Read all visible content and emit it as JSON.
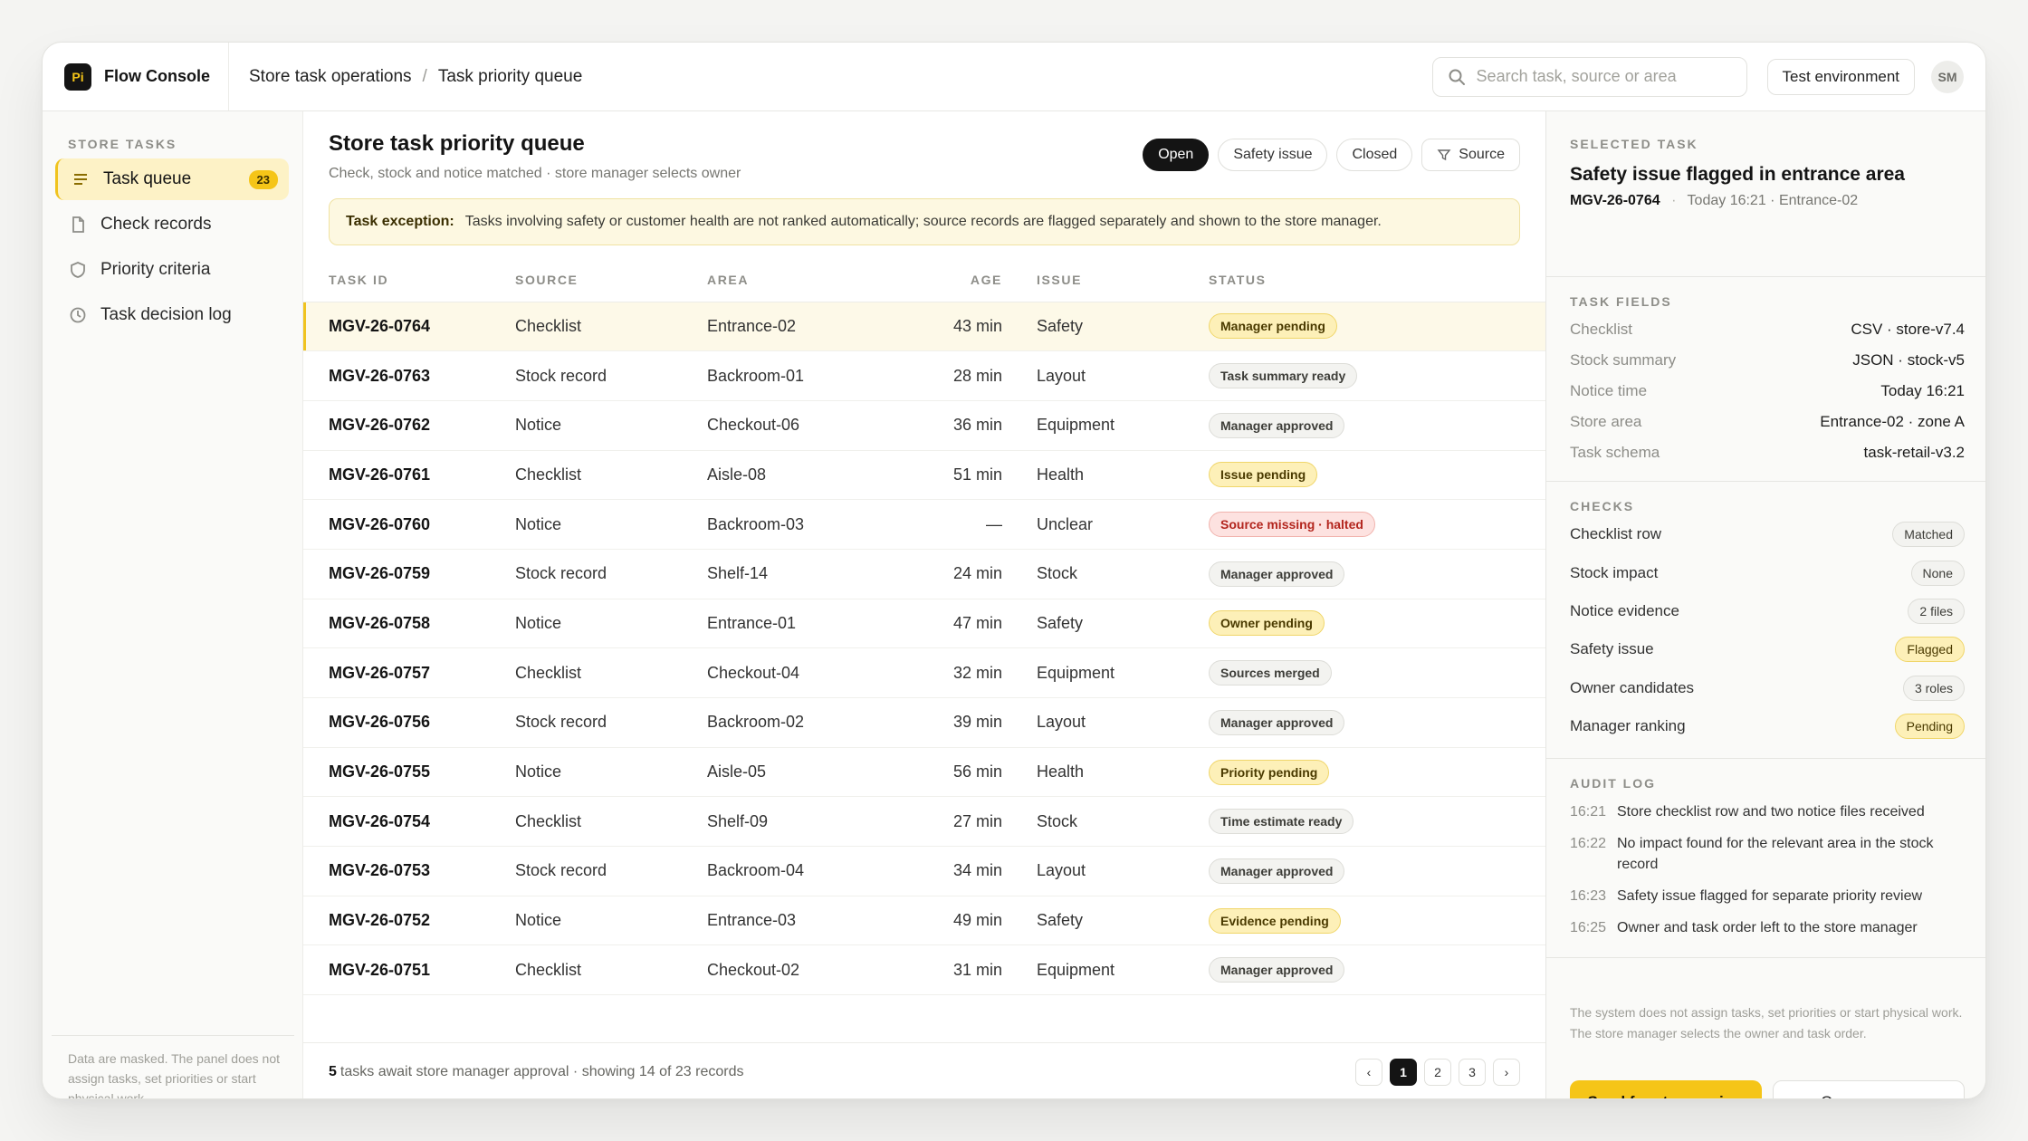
{
  "app": {
    "logo_text": "Pi",
    "name": "Flow Console"
  },
  "breadcrumb": [
    "Store task operations",
    "Task priority queue"
  ],
  "header": {
    "search_placeholder": "Search task, source or area",
    "environment_label": "Test environment",
    "user_initials": "SM"
  },
  "sidebar": {
    "heading": "STORE TASKS",
    "items": [
      {
        "label": "Task queue",
        "icon": "list-icon",
        "badge": "23",
        "active": true
      },
      {
        "label": "Check records",
        "icon": "file-icon"
      },
      {
        "label": "Priority criteria",
        "icon": "shield-icon"
      },
      {
        "label": "Task decision log",
        "icon": "clock-icon"
      }
    ],
    "footer": "Data are masked. The panel does not assign tasks, set priorities or start physical work."
  },
  "main": {
    "title": "Store task priority queue",
    "subtitle": "Check, stock and notice matched · store manager selects owner",
    "filters": [
      "Open",
      "Safety issue",
      "Closed",
      "Source"
    ],
    "exception_label": "Task exception:",
    "exception_text": "Tasks involving safety or customer health are not ranked automatically; source records are flagged separately and shown to the store manager.",
    "columns": [
      "TASK ID",
      "SOURCE",
      "AREA",
      "AGE",
      "ISSUE",
      "STATUS"
    ],
    "rows": [
      {
        "id": "MGV-26-0764",
        "source": "Checklist",
        "area": "Entrance-02",
        "age": "43 min",
        "issue": "Safety",
        "status": "Manager pending",
        "tone": "pending",
        "selected": true
      },
      {
        "id": "MGV-26-0763",
        "source": "Stock record",
        "area": "Backroom-01",
        "age": "28 min",
        "issue": "Layout",
        "status": "Task summary ready",
        "tone": "neutral"
      },
      {
        "id": "MGV-26-0762",
        "source": "Notice",
        "area": "Checkout-06",
        "age": "36 min",
        "issue": "Equipment",
        "status": "Manager approved",
        "tone": "neutral"
      },
      {
        "id": "MGV-26-0761",
        "source": "Checklist",
        "area": "Aisle-08",
        "age": "51 min",
        "issue": "Health",
        "status": "Issue pending",
        "tone": "pending"
      },
      {
        "id": "MGV-26-0760",
        "source": "Notice",
        "area": "Backroom-03",
        "age": "—",
        "issue": "Unclear",
        "status": "Source missing · halted",
        "tone": "halted"
      },
      {
        "id": "MGV-26-0759",
        "source": "Stock record",
        "area": "Shelf-14",
        "age": "24 min",
        "issue": "Stock",
        "status": "Manager approved",
        "tone": "neutral"
      },
      {
        "id": "MGV-26-0758",
        "source": "Notice",
        "area": "Entrance-01",
        "age": "47 min",
        "issue": "Safety",
        "status": "Owner pending",
        "tone": "pending"
      },
      {
        "id": "MGV-26-0757",
        "source": "Checklist",
        "area": "Checkout-04",
        "age": "32 min",
        "issue": "Equipment",
        "status": "Sources merged",
        "tone": "neutral"
      },
      {
        "id": "MGV-26-0756",
        "source": "Stock record",
        "area": "Backroom-02",
        "age": "39 min",
        "issue": "Layout",
        "status": "Manager approved",
        "tone": "neutral"
      },
      {
        "id": "MGV-26-0755",
        "source": "Notice",
        "area": "Aisle-05",
        "age": "56 min",
        "issue": "Health",
        "status": "Priority pending",
        "tone": "pending"
      },
      {
        "id": "MGV-26-0754",
        "source": "Checklist",
        "area": "Shelf-09",
        "age": "27 min",
        "issue": "Stock",
        "status": "Time estimate ready",
        "tone": "neutral"
      },
      {
        "id": "MGV-26-0753",
        "source": "Stock record",
        "area": "Backroom-04",
        "age": "34 min",
        "issue": "Layout",
        "status": "Manager approved",
        "tone": "neutral"
      },
      {
        "id": "MGV-26-0752",
        "source": "Notice",
        "area": "Entrance-03",
        "age": "49 min",
        "issue": "Safety",
        "status": "Evidence pending",
        "tone": "pending"
      },
      {
        "id": "MGV-26-0751",
        "source": "Checklist",
        "area": "Checkout-02",
        "age": "31 min",
        "issue": "Equipment",
        "status": "Manager approved",
        "tone": "neutral"
      }
    ],
    "footer_count": "5",
    "footer_text": "tasks await store manager approval · showing 14 of 23 records",
    "pages": [
      "‹",
      "1",
      "2",
      "3",
      "›"
    ],
    "current_page": "1"
  },
  "panel": {
    "selected_label": "SELECTED TASK",
    "selected_title": "Safety issue flagged in entrance area",
    "selected_id": "MGV-26-0764",
    "selected_meta": "Today 16:21 · Entrance-02",
    "fields_label": "TASK FIELDS",
    "fields": [
      {
        "k": "Checklist",
        "v": "CSV · store-v7.4"
      },
      {
        "k": "Stock summary",
        "v": "JSON · stock-v5"
      },
      {
        "k": "Notice time",
        "v": "Today 16:21"
      },
      {
        "k": "Store area",
        "v": "Entrance-02 · zone A"
      },
      {
        "k": "Task schema",
        "v": "task-retail-v3.2"
      }
    ],
    "checks_label": "CHECKS",
    "checks": [
      {
        "k": "Checklist row",
        "v": "Matched",
        "tone": "neutral"
      },
      {
        "k": "Stock impact",
        "v": "None",
        "tone": "neutral"
      },
      {
        "k": "Notice evidence",
        "v": "2 files",
        "tone": "neutral"
      },
      {
        "k": "Safety issue",
        "v": "Flagged",
        "tone": "pending"
      },
      {
        "k": "Owner candidates",
        "v": "3 roles",
        "tone": "neutral"
      },
      {
        "k": "Manager ranking",
        "v": "Pending",
        "tone": "pending"
      }
    ],
    "audit_label": "AUDIT LOG",
    "audit": [
      {
        "t": "16:21",
        "text": "Store checklist row and two notice files received"
      },
      {
        "t": "16:22",
        "text": "No impact found for the relevant area in the stock record"
      },
      {
        "t": "16:23",
        "text": "Safety issue flagged for separate priority review"
      },
      {
        "t": "16:25",
        "text": "Owner and task order left to the store manager"
      }
    ],
    "note": "The system does not assign tasks, set priorities or start physical work. The store manager selects the owner and task order.",
    "primary_action": "Send for store review",
    "secondary_action": "Open sources"
  }
}
